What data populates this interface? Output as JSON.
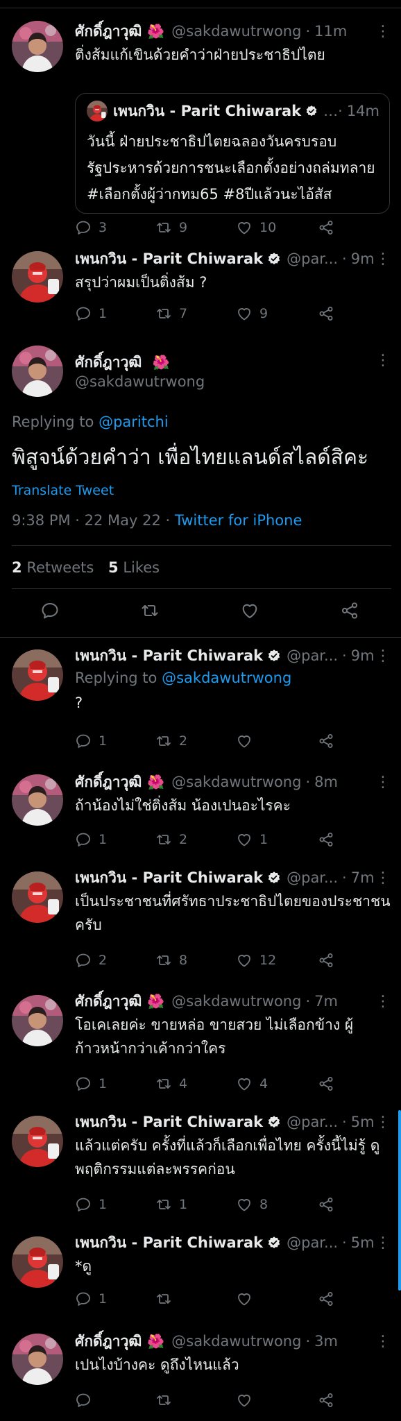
{
  "colors": {
    "background": "#000000",
    "accent": "#1d9bf0",
    "muted": "#71767b",
    "text": "#e7e9ea",
    "flower": "#f4899e"
  },
  "tweets": [
    {
      "name": "ศักดิ์ฎาวุฒิ",
      "flower": "🌺",
      "handle": "@sakdawutrwong",
      "time": "11m",
      "text": "ติ่งส้มแก้เขินด้วยคำว่าฝ่ายประชาธิปไตย",
      "quote": {
        "name": "เพนกวิน - Parit Chiwarak",
        "time": "14m",
        "text": "วันนี้ ฝ่ายประชาธิปไตยฉลองวันครบรอบรัฐประหารด้วยการชนะเลือกตั้งอย่างถล่มทลาย #เลือกตั้งผู้ว่ากทม65 #8ปีแล้วนะไอ้สัส"
      },
      "replies": "3",
      "retweets": "9",
      "likes": "10"
    },
    {
      "name": "เพนกวิน - Parit Chiwarak",
      "handle": "@par...",
      "time": "9m",
      "text": "สรุปว่าผมเป็นติ่งส้ม ?",
      "replies": "1",
      "retweets": "7",
      "likes": "9"
    }
  ],
  "main": {
    "name": "ศักดิ์ฎาวุฒิ",
    "flower": "🌺",
    "handle": "@sakdawutrwong",
    "replying_prefix": "Replying to",
    "replying_to": "@paritchi",
    "text": "พิสูจน์ด้วยคำว่า เพื่อไทยแลนด์สไลด์สิคะ",
    "translate": "Translate Tweet",
    "timestamp": "9:38 PM · 22 May 22 · ",
    "source": "Twitter for iPhone",
    "retweets_count": "2",
    "retweets_label": "Retweets",
    "likes_count": "5",
    "likes_label": "Likes"
  },
  "replies": [
    {
      "name": "เพนกวิน - Parit Chiwarak",
      "handle": "@par...",
      "time": "9m",
      "replying_prefix": "Replying to",
      "replying_to": "@sakdawutrwong",
      "text": "?",
      "replies": "1",
      "retweets": "2",
      "likes": ""
    },
    {
      "name": "ศักดิ์ฎาวุฒิ",
      "flower": "🌺",
      "handle": "@sakdawutrwong",
      "time": "8m",
      "text": "ถ้าน้องไม่ใช่ติ่งส้ม น้องเปนอะไรคะ",
      "replies": "1",
      "retweets": "2",
      "likes": "1"
    },
    {
      "name": "เพนกวิน - Parit Chiwarak",
      "handle": "@par...",
      "time": "7m",
      "text": "เป็นประชาชนที่ศรัทธาประชาธิปไตยของประชาชนครับ",
      "replies": "2",
      "retweets": "8",
      "likes": "12"
    },
    {
      "name": "ศักดิ์ฎาวุฒิ",
      "flower": "🌺",
      "handle": "@sakdawutrwong",
      "time": "7m",
      "text": "โอเคเลยค่ะ ขายหล่อ ขายสวย ไม่เลือกข้าง ผู้ก้าวหน้ากว่าเค้ากว่าใคร",
      "replies": "1",
      "retweets": "4",
      "likes": "4"
    },
    {
      "name": "เพนกวิน - Parit Chiwarak",
      "handle": "@par...",
      "time": "5m",
      "text": "แล้วแต่ครับ ครั้งที่แล้วก็เลือกเพื่อไทย ครั้งนี้ไม่รู้ ดูพฤติกรรมแต่ละพรรคก่อน",
      "replies": "1",
      "retweets": "1",
      "likes": "8"
    },
    {
      "name": "เพนกวิน - Parit Chiwarak",
      "handle": "@par...",
      "time": "5m",
      "text": "*ดู",
      "replies": "1",
      "retweets": "",
      "likes": ""
    },
    {
      "name": "ศักดิ์ฎาวุฒิ",
      "flower": "🌺",
      "handle": "@sakdawutrwong",
      "time": "3m",
      "text": "เปนไงบ้างคะ ดูถึงไหนแล้ว",
      "replies": "",
      "retweets": "",
      "likes": ""
    }
  ]
}
